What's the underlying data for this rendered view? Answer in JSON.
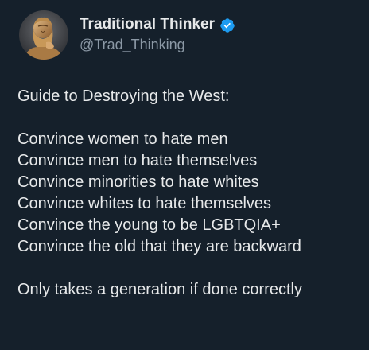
{
  "author": {
    "display_name": "Traditional Thinker",
    "handle": "@Trad_Thinking",
    "verified": true,
    "verified_icon": "verified-badge-icon",
    "accent_color": "#1d9bf0",
    "avatar": "bust-portrait-avatar"
  },
  "tweet": {
    "intro": "Guide to Destroying the West:",
    "lines": [
      "Convince women to hate men",
      "Convince men to hate themselves",
      "Convince minorities to hate whites",
      "Convince whites to hate themselves",
      "Convince the young to be LGBTQIA+",
      "Convince the old that they are backward"
    ],
    "closing": "Only takes a generation if done correctly"
  },
  "theme": {
    "background": "#15202b",
    "text": "#e7e9ea",
    "muted": "#8b98a5"
  }
}
